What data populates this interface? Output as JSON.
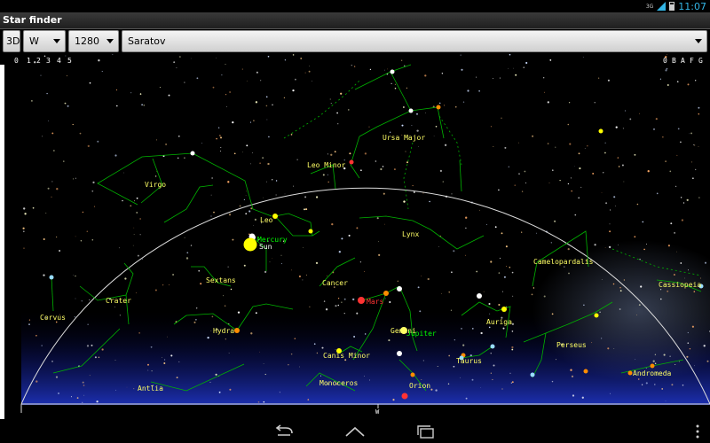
{
  "status_bar": {
    "time": "11:07",
    "network": "3G"
  },
  "app": {
    "title": "Star finder"
  },
  "toolbar": {
    "mode_button": "3D",
    "direction_value": "W",
    "resolution_value": "1280",
    "location_value": "Saratov"
  },
  "scales": {
    "left": [
      "0",
      "1",
      "2",
      "3",
      "4",
      "5"
    ],
    "right": [
      "0",
      "B",
      "A",
      "F",
      "G"
    ]
  },
  "horizon": {
    "direction_label": "W"
  },
  "constellations": [
    "Virgo",
    "Leo Minor",
    "Ursa Major",
    "Leo",
    "Lynx",
    "Sextans",
    "Cancer",
    "Crater",
    "Corvus",
    "Hydra",
    "Canis Minor",
    "Gemini",
    "Auriga",
    "Camelopardalis",
    "Cassiopeia",
    "Perseus",
    "Taurus",
    "Andromeda",
    "Orion",
    "Monoceros",
    "Antlia"
  ],
  "planets": [
    "Mercury",
    "Sun",
    "Mars",
    "Jupiter"
  ],
  "colors": {
    "constellation_label": "#ffff66",
    "constellation_line": "#00b400",
    "mercury": "#00ff00",
    "sun": "#ffff00",
    "mars": "#ff3333",
    "jupiter": "#00ff00",
    "accent": "#33b5e5"
  }
}
